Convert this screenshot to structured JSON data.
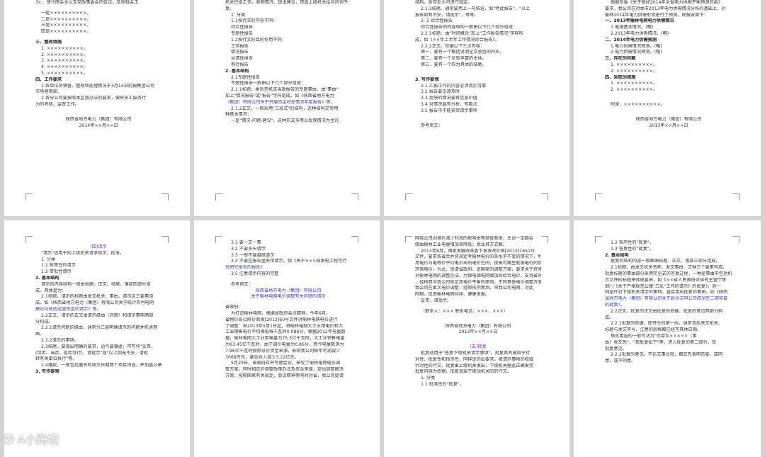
{
  "pages": [
    {
      "lines": [
        [
          "n",
          "为：，使代研会全以及党政事委会的召议；及铜批会工"
        ],
        [
          "g",
          ""
        ],
        [
          "ind",
          "一是××××××××××。"
        ],
        [
          "ind",
          "二是××××××××××。"
        ],
        [
          "ind",
          "三是××××××××××。"
        ],
        [
          "ind",
          "四是××××××××××。"
        ],
        [
          "g",
          ""
        ],
        [
          "h",
          "三、整改措施"
        ],
        [
          "ind",
          "1. ××××××××××。"
        ],
        [
          "ind",
          "2. ××××××××××。"
        ],
        [
          "ind",
          "3. ××××××××××。"
        ],
        [
          "ind",
          "4. ××××××××××。"
        ],
        [
          "ind",
          "5. ××××××××××。"
        ],
        [
          "h",
          "四、工作要求"
        ],
        [
          "ind",
          "1.各单位将诸查、整改和处理情况于3月14日前报集团公司"
        ],
        [
          "n",
          "市场营销部。"
        ],
        [
          "ind",
          "2.各分公司要按照本监督办法的要求，做好员工服务行"
        ],
        [
          "n",
          "为的考核、监督工作。"
        ],
        [
          "g2",
          ""
        ],
        [
          "c",
          "陕西省地方电力（集团）有限公司"
        ],
        [
          "c",
          "2014年××月××日"
        ]
      ]
    },
    {
      "lines": [
        [
          "n",
          "机关已组工作，表明情况、提出建议，审直上级机关给与问询予"
        ],
        [
          "n",
          "复。"
        ],
        [
          "ind",
          "1. 分类"
        ],
        [
          "ind",
          "1.1按行文的内容不同："
        ],
        [
          "ind",
          "综合性报告"
        ],
        [
          "ind",
          "专题性报告"
        ],
        [
          "ind",
          "1.2按行文的目的作用不同："
        ],
        [
          "ind",
          "工作报告"
        ],
        [
          "ind",
          "情况报告"
        ],
        [
          "ind",
          "呈请性报告"
        ],
        [
          "ind",
          "例行报告"
        ],
        [
          "h",
          "2. 基本结构"
        ],
        [
          "ind",
          "2.1专题性报告"
        ],
        [
          "ind",
          "专题性报告一般由以下几个部分组成："
        ],
        [
          "ind",
          "2.1.1标题。类别至机该当政报告的专题事由，由\"事由\""
        ],
        [
          "n",
          "加上\"情况报告\"或\"报告\"字样组成。如《陕西省地方电力"
        ],
        [
          "lnk",
          "（集团）有限公司关于开展资金收支情况年度报告》等。"
        ],
        [
          "ind",
          "2.1.2正文。一般采用\"三段式\"的结构，这种结构又常用"
        ],
        [
          "n",
          "种基本情况："
        ],
        [
          "ind",
          "一是\"情况-问题-建议\"。这种形式多用以反映情况为主的"
        ]
      ]
    },
    {
      "lines": [
        [
          "n",
          "结构，各存处大问进行规定。"
        ],
        [
          "ind",
          "2.1.3结尾。通常要用上一句结语，如\"特此报告\"，\"以上"
        ],
        [
          "n",
          "报告如有不妥，请批示\"，等等。"
        ],
        [
          "ind",
          "2. 2 综合性报告"
        ],
        [
          "ind",
          "综合性报告的内容结构一般由以下几个部分组成："
        ],
        [
          "ind",
          "2.2.1标题。由\"时间概念\"加上\"工作报告情况\"字样构"
        ],
        [
          "n",
          "成，如《××年上半年工作情况综合报告》。"
        ],
        [
          "ind",
          "2.2.2正文。依据以下三点内容："
        ],
        [
          "ind",
          "第一，要有一个概括说明全文总旨的开头。"
        ],
        [
          "ind",
          "第二，要有一个论较丰富的主体。"
        ],
        [
          "ind",
          "第三，要有一个较为具体的结尾。"
        ],
        [
          "g2",
          ""
        ],
        [
          "h",
          "3. 写作要领"
        ],
        [
          "ind",
          "3.1 汇报工作的内容必须真实可靠"
        ],
        [
          "ind",
          "3.2 报告要迅速及时"
        ],
        [
          "ind",
          "3.3 反映的情况要有信息价值"
        ],
        [
          "ind",
          "3.4 对情况要有分析，有看法"
        ],
        [
          "ind",
          "3.5 报告中不能夹带请示事项"
        ],
        [
          "g2",
          ""
        ],
        [
          "ind",
          "参考例文："
        ]
      ]
    },
    {
      "lines": [
        [
          "ind",
          "根据安委《关于做好2014年全省电力供需平衡预测的函》"
        ],
        [
          "n",
          "要求，我公司在对本市2013年电力供需情况分析的基础上，对"
        ],
        [
          "n",
          "榆林2014年电力供需形势进行了预测。现报告如下："
        ],
        [
          "h",
          "一、2013年榆林电网电力供需情况"
        ],
        [
          "ind",
          "1.电源基本情况。(略)"
        ],
        [
          "ind",
          "2.2013年电力供需情况。(略)"
        ],
        [
          "h",
          "二、2014年电力供需预测"
        ],
        [
          "ind",
          "1.电力供需情况预测。(略)"
        ],
        [
          "ind",
          "2.电力供需情况预测。(略)"
        ],
        [
          "h",
          "三、存在的问题"
        ],
        [
          "ind",
          "1. ××××××××××。"
        ],
        [
          "ind",
          "2. ××××××××××。"
        ],
        [
          "h",
          "四、采取的措施"
        ],
        [
          "ind",
          "1. ××××××××××。"
        ],
        [
          "ind",
          "2. ××××××××××。"
        ],
        [
          "g2",
          ""
        ],
        [
          "ind",
          "附录：××××××××××。"
        ],
        [
          "g2",
          ""
        ],
        [
          "c",
          "陕西省地方电力（集团）有限公司"
        ],
        [
          "c",
          "2013年××月××日"
        ]
      ]
    },
    {
      "lines": [
        [
          "g",
          ""
        ],
        [
          "g",
          ""
        ],
        [
          "t",
          "(四)请示"
        ],
        [
          "ind",
          "\"请示\"适用于向上级机关请求指示、批准。"
        ],
        [
          "ind",
          "1. 分类"
        ],
        [
          "ind",
          "1.1 政策性的请示"
        ],
        [
          "ind",
          "1.2 审批性请示"
        ],
        [
          "h",
          "2. 基本结构"
        ],
        [
          "ind",
          "请示的内容结构一般由标题、正文、结尾、落款四部分组"
        ],
        [
          "n",
          "成，具体是为："
        ],
        [
          "ind",
          "2.1标题。请示的标题由发文机关、事由、请示这三要素组"
        ],
        [
          "n",
          "成。如《陕西省地方电力（集团）有限公司关于统计农村电网"
        ],
        [
          "lnk",
          "建设与改造运营资金的请示》等。"
        ],
        [
          "ind",
          "2.2正文。请示的正文由请示缘由（问题）和请示事项两部"
        ],
        [
          "n",
          "分构成。"
        ],
        [
          "ind",
          "2.2.1请示问题的缘由，通常分三层明确请示的问题并陈述理"
        ],
        [
          "n",
          "由。"
        ],
        [
          "ind",
          "2.2.2请示的事项。"
        ],
        [
          "ind",
          "2.3结尾。要提出明确的要求，语气要谦虚，可写作\"妥否，"
        ],
        [
          "n",
          "(可否、当否、是否可行)，请批示\"或\"以上如无不妥，请批"
        ],
        [
          "n",
          "转有关单位执行\"等。"
        ],
        [
          "ind",
          "2.4落款。一般包括署名和成文日期两个项目内容，并加盖公章。"
        ],
        [
          "h",
          "3. 写作要领"
        ]
      ]
    },
    {
      "lines": [
        [
          "g",
          ""
        ],
        [
          "ind",
          "3.1 要一文一事"
        ],
        [
          "ind",
          "3.2 不要多头请示"
        ],
        [
          "ind",
          "3.3 一般不要越级请示"
        ],
        [
          "ind",
          "3.4 不要在报告里夹带请示。如《关于×××拍发电工程可行"
        ],
        [
          "lnk",
          "性研究报告的报告》"
        ],
        [
          "ind",
          "3.5 注意请示内容的完整"
        ],
        [
          "g",
          ""
        ],
        [
          "ind",
          "参考例文："
        ],
        [
          "c lnk",
          "陕西省地方电力（集团）有限公司"
        ],
        [
          "c lnk",
          "关于榆林电网电价调整有关问题的请示"
        ],
        [
          "g",
          ""
        ],
        [
          "n",
          "省政府："
        ],
        [
          "ind",
          "为打造榆林电网，根据省政府会议精神，今年6月，"
        ],
        [
          "n",
          "省物价局以陕价商发[2013]60号文件对榆林电网电价进行"
        ],
        [
          "n",
          "了调整：自2013年5月1日起，将榆林电网大工业用电价和大"
        ],
        [
          "n",
          "工业销售电价平均降低每千瓦时0.086分，根据2012年电量数"
        ],
        [
          "n",
          "据，榆林电网大工业用电量为75.5亿千瓦时，大工业销售电量"
        ],
        [
          "n",
          "为63.45亿千瓦时，由于调价电量为0.86分，而今电量数测为"
        ],
        [
          "n",
          "7.96亿千瓦时按照导价资金来源，影响我公司每年利润减少"
        ],
        [
          "n",
          "3068万元，营业收入减少3.22亿元。"
        ],
        [
          "ind",
          "5月29日，省政府召开专题会议，研究了榆林电网电价调"
        ],
        [
          "n",
          "整方案，同时相应的调整政策办法及资金来源，提出调整解决"
        ],
        [
          "n",
          "方案，按照国家有关规定，会议精神等同时对省，我公司提请"
        ]
      ]
    },
    {
      "lines": [
        [
          "n",
          "网我公司因调价减少利润的影响由等部省政发，主设一定额会"
        ],
        [
          "n",
          "级由榆林工业电量增加来降低；会业其方式解。"
        ],
        [
          "ind",
          "2013年8月，国家发展改革委下发发改价格[2013]1651号"
        ],
        [
          "n",
          "文件，要求各省合并将规定考榆林电价的各水平不变的情况下，利"
        ],
        [
          "n",
          "用电价与电等价平均电价出的电价空间，提高可再生能源电价附加和"
        ],
        [
          "n",
          "环保电价。为此，恳请省政府，是国家的调整方案，要求关于将降低"
        ],
        [
          "n",
          "对榆林电网的调整办法。为保电源电网增加后综合电价，支持省外"
        ],
        [
          "n",
          "，经核算与我公司规定和电价平衡的原则，不同意低电价调整方案。"
        ],
        [
          "n",
          "我公司在本次电价调整，经审核同意后，将我公司电网，对此"
        ],
        [
          "n",
          "同期，促进榆林电网持续、健康发展。"
        ],
        [
          "ind",
          "妥否，请批示。"
        ],
        [
          "g",
          ""
        ],
        [
          "ind",
          "（联系人：×××  联系电话：×××、×××）"
        ],
        [
          "g2",
          ""
        ],
        [
          "c",
          "陕西省地方电力（集团）有限公司"
        ],
        [
          "c",
          "2013年××月××日"
        ],
        [
          "g2",
          ""
        ],
        [
          "t",
          "(五)批复"
        ],
        [
          "ind",
          "批复适用于\"答复下级机关请示事项\"。批复具有被指令针"
        ],
        [
          "n",
          "对性、批复性和指示性，同样是的出要求，被请示事物的权威"
        ],
        [
          "n",
          "针对性的行文，批复由上级机关发出，下级机关据此正确发觉"
        ],
        [
          "n",
          "批复内容为依据，批复是属于被动机关的的行文。"
        ],
        [
          "ind",
          "1. 分类"
        ],
        [
          "ind",
          "1.1 批准性的\"批复\"。"
        ]
      ]
    },
    {
      "lines": [
        [
          "g",
          ""
        ],
        [
          "ind",
          "1.2 指示性的\"批复\"。"
        ],
        [
          "ind",
          "1.3 答复性的\"批复\"。"
        ],
        [
          "h",
          "2. 基本结构"
        ],
        [
          "ind",
          "批复的结构内容一般都由标题、正文、落款三部分组成。"
        ],
        [
          "ind",
          "2.1标题。由发文机关名称、发文事由、文种三个要素构成。"
        ],
        [
          "n",
          "批复标题的事由部分采用完全式的答复过程，一种是事由中包括机关请"
        ],
        [
          "n",
          "示文件的标题来体现要由，如《××省人民政府对省有主管厅等"
        ],
        [
          "n",
          "部门《关于严格规范公路\"三乱\"工作的请示》的批复》；另一"
        ],
        [
          "n",
          "种是针对下级机关请示的事项，直接用出批复的事由，如《陕西"
        ],
        [
          "lnk",
          "省地方电力（集团）有限公司关于延长汉中公司成型区二期项目"
        ],
        [
          "lnk",
          "的批复》。"
        ],
        [
          "ind",
          "2.2正文。批复的正文由批复的依据、批复的意见两部分构"
        ],
        [
          "n",
          "成。"
        ],
        [
          "ind",
          "2.2.1批复的依据，即开头的第一段，通常包括来文机关、"
        ],
        [
          "n",
          "标题与发文字号，注意的层格都已经写具体日期。"
        ],
        [
          "ind",
          "格式用语的一般写法为\"你单位×××××（事"
        ],
        [
          "n",
          "由）收文悉\"，\"现批复如下\"等，进入批复的第二部分，及"
        ],
        [
          "n",
          "批复意见。"
        ],
        [
          "ind",
          "2.2.2批复的意见。不论文事长短，都应先表明态度，或同"
        ],
        [
          "n",
          "意，或不同意。"
        ]
      ]
    }
  ],
  "watermark": "ⓦ A小跨境"
}
